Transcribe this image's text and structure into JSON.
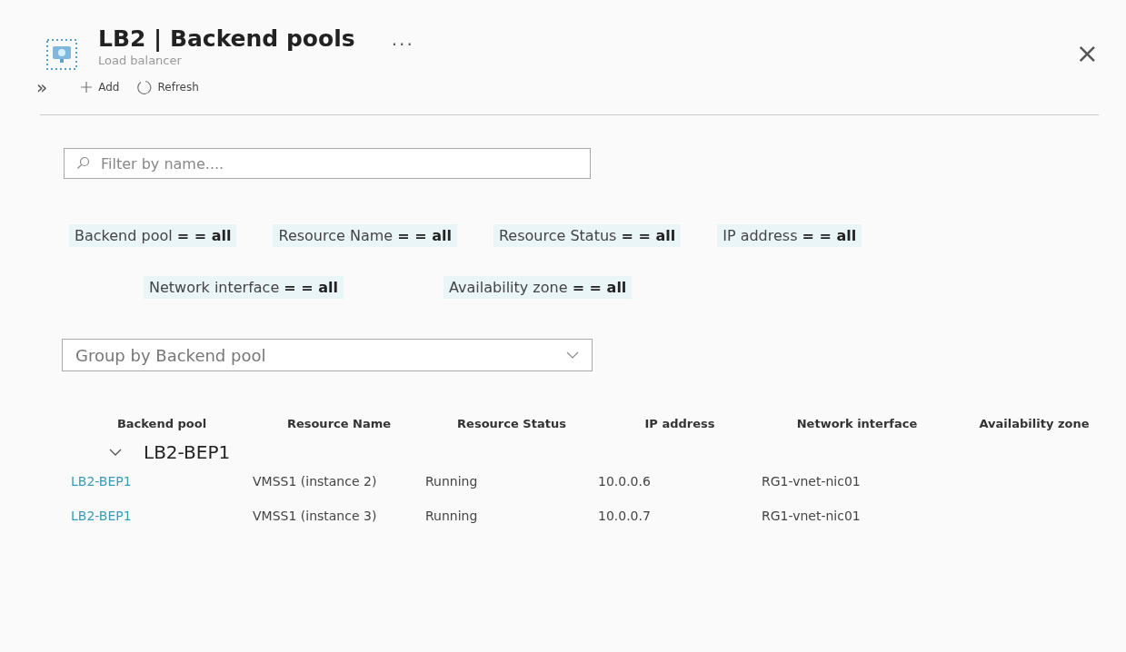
{
  "header": {
    "title": "LB2 | Backend pools",
    "subtitle": "Load balancer",
    "more": "...",
    "close": "×"
  },
  "toolbar": {
    "expand": "»",
    "buttons": [
      {
        "kind": "add",
        "label": "Add"
      },
      {
        "kind": "refresh",
        "label": "Refresh"
      }
    ]
  },
  "search": {
    "placeholder": "Filter by name...."
  },
  "filters": [
    {
      "text": "Backend pool **= = all**"
    },
    {
      "text": "Resource Name **= = all**"
    },
    {
      "text": "Resource Status **= = all**"
    },
    {
      "text": "IP address **= = all**"
    },
    {
      "text": "Network interface **= = all**"
    },
    {
      "text": "Availability zone **= = all**"
    }
  ],
  "group_by": {
    "value": "Group by Backend pool"
  },
  "table": {
    "columns": [
      "Backend pool",
      "Resource Name",
      "Resource Status",
      "IP address",
      "Network interface",
      "Availability zone"
    ],
    "groups": [
      {
        "name": "LB2-BEP1",
        "expanded": true,
        "rows": [
          {
            "cells": [
              "LB2-BEP1",
              "VMSS1 (instance 2)",
              "Running",
              "10.0.0.6",
              "RG1-vnet-nic01"
            ]
          },
          {
            "cells": [
              "LB2-BEP1",
              "VMSS1 (instance 3)",
              "Running",
              "10.0.0.7",
              "RG1-vnet-nic01"
            ]
          }
        ]
      }
    ]
  }
}
